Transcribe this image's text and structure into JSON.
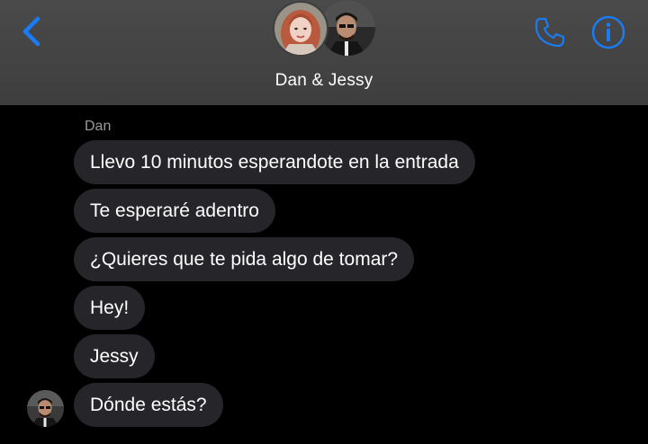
{
  "header": {
    "title": "Dan & Jessy",
    "accent_color": "#1a7cf5",
    "back_icon": "chevron-left-icon",
    "call_icon": "phone-icon",
    "info_icon": "info-icon"
  },
  "conversation": {
    "sender_name": "Dan",
    "messages": [
      "Llevo 10 minutos esperandote en la entrada",
      "Te esperaré adentro",
      "¿Quieres que te pida algo de tomar?",
      "Hey!",
      "Jessy",
      "Dónde estás?"
    ]
  }
}
